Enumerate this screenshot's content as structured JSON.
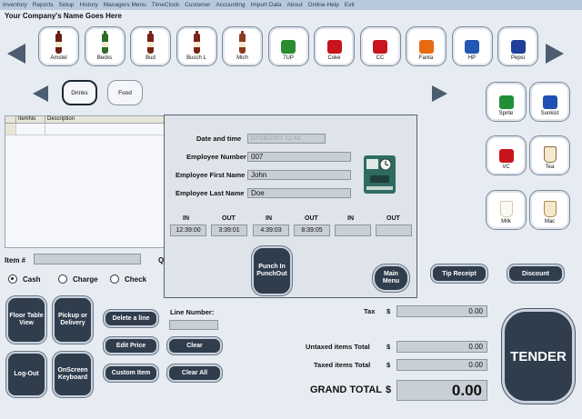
{
  "menu": [
    "Inventory",
    "Reports",
    "Setup",
    "History",
    "Managers Menu",
    "TimeClock",
    "Customer",
    "Accounting",
    "Import Data",
    "About",
    "Online-Help",
    "Exit"
  ],
  "company_name": "Your Company's Name Goes Here",
  "products_top": [
    {
      "label": "Amstel",
      "icon": "beer-bottle-icon",
      "color": "#6b1f12"
    },
    {
      "label": "Becks",
      "icon": "beer-bottle-icon",
      "color": "#2e6b24"
    },
    {
      "label": "Bud",
      "icon": "beer-bottle-icon",
      "color": "#7a2417"
    },
    {
      "label": "Busch L",
      "icon": "beer-bottle-icon",
      "color": "#7a2417"
    },
    {
      "label": "Mich",
      "icon": "beer-bottle-icon",
      "color": "#8a3b1e"
    },
    {
      "label": "7UP",
      "icon": "soda-can-icon",
      "color": "#2a8b2f"
    },
    {
      "label": "Coke",
      "icon": "soda-can-icon",
      "color": "#c8141c"
    },
    {
      "label": "CC",
      "icon": "soda-can-icon",
      "color": "#c8141c"
    },
    {
      "label": "Fanta",
      "icon": "soda-can-icon",
      "color": "#e86a10"
    },
    {
      "label": "HP",
      "icon": "soda-can-icon",
      "color": "#2456b4"
    },
    {
      "label": "Pepsi",
      "icon": "soda-can-icon",
      "color": "#1f3f9c"
    }
  ],
  "products_side": [
    {
      "label": "Sprite",
      "icon": "soda-can-icon",
      "color": "#1f8f3a"
    },
    {
      "label": "Sunkist",
      "icon": "soda-can-icon",
      "color": "#1f4fb0"
    },
    {
      "label": "VC",
      "icon": "soda-can-icon",
      "color": "#c8141c"
    },
    {
      "label": "Tea",
      "icon": "tea-cup-icon",
      "color": "#8b6a3a"
    },
    {
      "label": "Milk",
      "icon": "milk-cup-icon",
      "color": "#d8cba8"
    },
    {
      "label": "Mac",
      "icon": "coffee-cup-icon",
      "color": "#b0864a"
    }
  ],
  "categories": [
    {
      "label": "Drinks",
      "active": true
    },
    {
      "label": "Food",
      "active": false
    }
  ],
  "grid": {
    "headers": [
      "ItemNo",
      "Description"
    ]
  },
  "item_label": "Item #",
  "qty_label": "Q",
  "payment": [
    {
      "label": "Cash",
      "selected": true
    },
    {
      "label": "Charge",
      "selected": false
    },
    {
      "label": "Check",
      "selected": false
    }
  ],
  "buttons": {
    "floor": "Floor Table View",
    "pickup": "Pickup or Delivery",
    "logout": "Log-Out",
    "keyboard": "OnScreen Keyboard",
    "delete_line": "Delete a line",
    "edit_price": "Edit Price",
    "custom_item": "Custom Item",
    "clear": "Clear",
    "clear_all": "Clear All",
    "tip_receipt": "Tip Receipt",
    "discount": "Discount",
    "tender": "TENDER"
  },
  "line_number_label": "Line Number:",
  "totals": {
    "currency": "$",
    "tax_label": "Tax",
    "tax": "0.00",
    "untaxed_label": "Untaxed items Total",
    "untaxed": "0.00",
    "taxed_label": "Taxed items Total",
    "taxed": "0.00",
    "grand_label": "GRAND TOTAL",
    "grand": "0.00"
  },
  "timeclock": {
    "date_label": "Date and time",
    "date_value": "07/18/2007 12:43",
    "emp_num_label": "Employee Number",
    "emp_num": "007",
    "first_label": "Employee First Name",
    "first": "John",
    "last_label": "Employee Last Name",
    "last": "Doe",
    "in_label": "IN",
    "out_label": "OUT",
    "punches": [
      {
        "in": "12:39:00",
        "out": "3:39:01"
      },
      {
        "in": "4:39:03",
        "out": "8:39:05"
      },
      {
        "in": "",
        "out": ""
      }
    ],
    "punch_button": "Punch In PunchOut",
    "main_menu_button": "Main Menu",
    "clock_icon": "time-clock-icon"
  }
}
